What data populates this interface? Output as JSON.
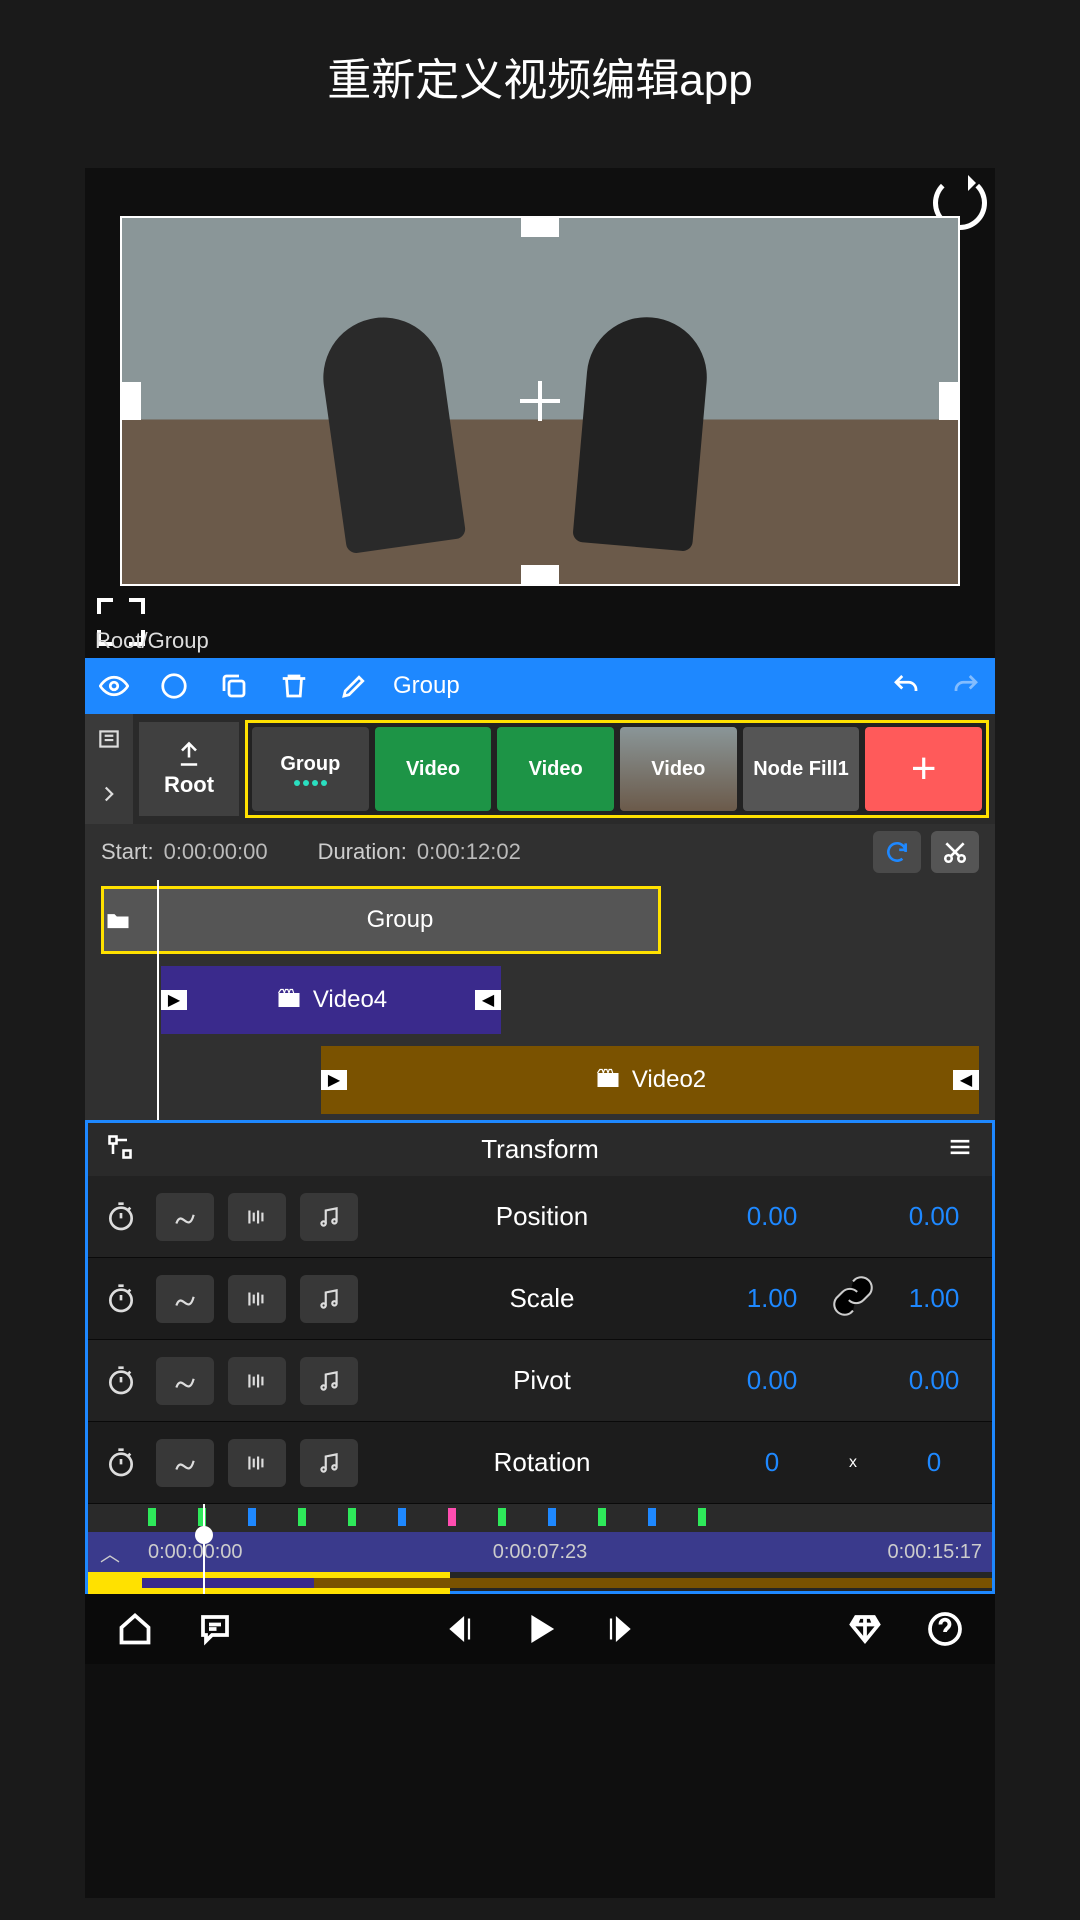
{
  "page_title": "重新定义视频编辑app",
  "breadcrumb": "Root/Group",
  "toolbar": {
    "edit_label": "Group"
  },
  "root_label": "Root",
  "nodes": [
    {
      "label": "Group",
      "cls": "group"
    },
    {
      "label": "Video",
      "cls": "video"
    },
    {
      "label": "Video",
      "cls": "video"
    },
    {
      "label": "Video",
      "cls": "video4"
    },
    {
      "label": "Node Fill1",
      "cls": "fill"
    }
  ],
  "add_symbol": "+",
  "time": {
    "start_label": "Start:",
    "start_value": "0:00:00:00",
    "duration_label": "Duration:",
    "duration_value": "0:00:12:02"
  },
  "clips": {
    "group": "Group",
    "video4": "Video4",
    "video2": "Video2"
  },
  "transform": {
    "title": "Transform",
    "rows": [
      {
        "name": "Position",
        "v1": "0.00",
        "v2": "0.00",
        "link": false
      },
      {
        "name": "Scale",
        "v1": "1.00",
        "v2": "1.00",
        "link": true
      },
      {
        "name": "Pivot",
        "v1": "0.00",
        "v2": "0.00",
        "link": false
      },
      {
        "name": "Rotation",
        "v1": "0",
        "v2": "0",
        "link": false,
        "mid": "x"
      }
    ]
  },
  "ruler": {
    "t1": "0:00:00:00",
    "t2": "0:00:07:23",
    "t3": "0:00:15:17"
  }
}
